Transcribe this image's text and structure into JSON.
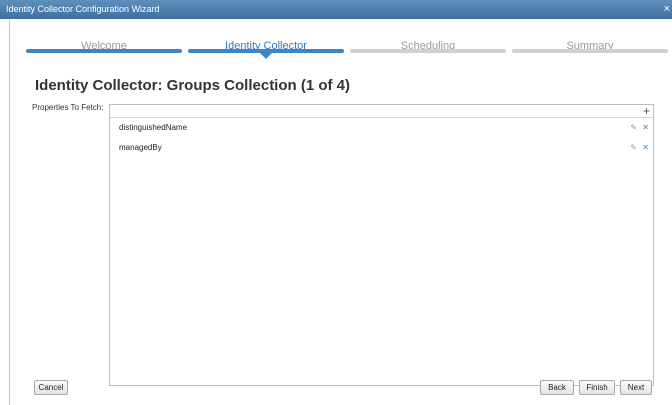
{
  "window": {
    "title": "Identity Collector Configuration Wizard",
    "close_glyph": "×"
  },
  "steps": [
    {
      "label": "Welcome",
      "state": "done"
    },
    {
      "label": "Identity Collector",
      "state": "active"
    },
    {
      "label": "Scheduling",
      "state": "pending"
    },
    {
      "label": "Summary",
      "state": "pending"
    }
  ],
  "page": {
    "title": "Identity Collector: Groups Collection (1 of 4)"
  },
  "properties": {
    "label": "Properties To Fetch:",
    "add_glyph": "+",
    "items": [
      {
        "name": "distinguishedName",
        "edit_icon": "pencil-icon",
        "remove_icon": "x-icon"
      },
      {
        "name": "managedBy",
        "edit_icon": "pencil-icon",
        "remove_icon": "x-icon"
      }
    ]
  },
  "buttons": {
    "cancel": "Cancel",
    "back": "Back",
    "finish": "Finish",
    "next": "Next"
  },
  "colors": {
    "accent": "#3d85c6",
    "titlebar": "#4a7aab"
  }
}
